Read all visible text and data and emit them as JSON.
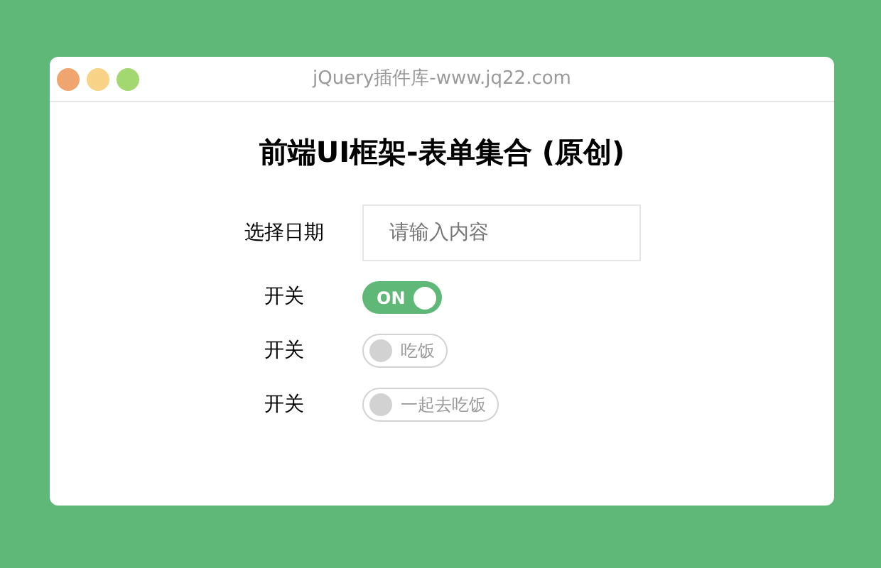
{
  "window": {
    "title": "jQuery插件库-www.jq22.com"
  },
  "heading": "前端UI框架-表单集合 (原创)",
  "rows": [
    {
      "kind": "input",
      "label": "选择日期",
      "placeholder": "请输入内容"
    },
    {
      "kind": "switch",
      "label": "开关",
      "on": true,
      "text": "ON"
    },
    {
      "kind": "switch",
      "label": "开关",
      "on": false,
      "text": "吃饭"
    },
    {
      "kind": "switch",
      "label": "开关",
      "on": false,
      "text": "一起去吃饭"
    }
  ]
}
